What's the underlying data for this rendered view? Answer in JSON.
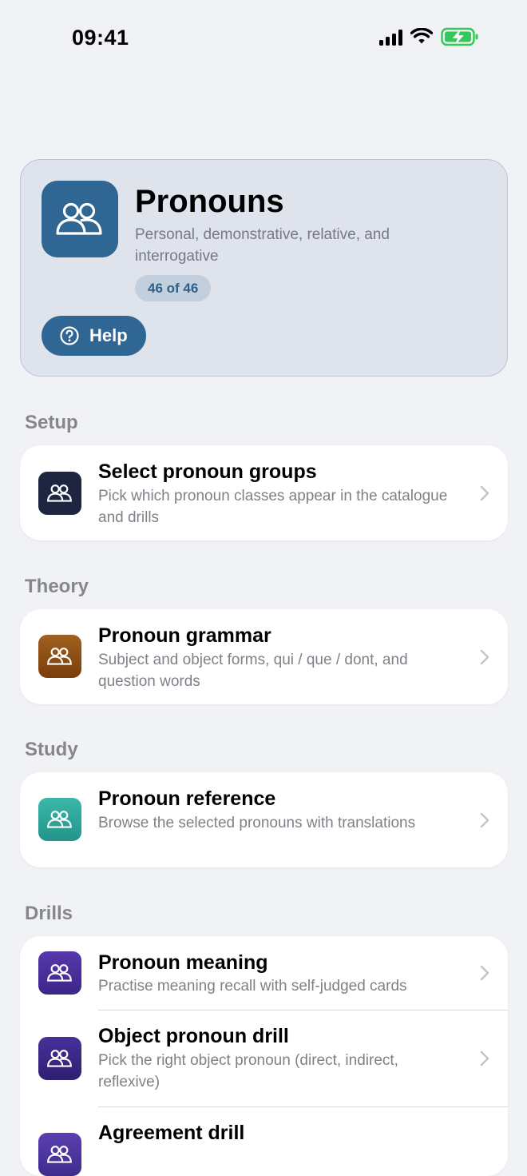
{
  "status": {
    "time": "09:41"
  },
  "hero": {
    "title": "Pronouns",
    "subtitle": "Personal, demonstrative, relative, and interrogative",
    "badge": "46 of 46",
    "help_label": "Help"
  },
  "sections": {
    "setup": {
      "header": "Setup",
      "items": [
        {
          "title": "Select pronoun groups",
          "subtitle": "Pick which pronoun classes appear in the catalogue and drills",
          "icon": "people-icon",
          "color": "#1e2540"
        }
      ]
    },
    "theory": {
      "header": "Theory",
      "items": [
        {
          "title": "Pronoun grammar",
          "subtitle": "Subject and object forms, qui / que / dont, and question words",
          "icon": "people-icon",
          "color": "#8a4a14"
        }
      ]
    },
    "study": {
      "header": "Study",
      "items": [
        {
          "title": "Pronoun reference",
          "subtitle": "Browse the selected pronouns with translations",
          "icon": "people-icon",
          "color": "#2fa79c"
        }
      ]
    },
    "drills": {
      "header": "Drills",
      "items": [
        {
          "title": "Pronoun meaning",
          "subtitle": "Practise meaning recall with self-judged cards",
          "icon": "people-icon",
          "color": "#4a2f9c"
        },
        {
          "title": "Object pronoun drill",
          "subtitle": "Pick the right object pronoun (direct, indirect, reflexive)",
          "icon": "people-icon",
          "color": "#3b2a88"
        },
        {
          "title": "Agreement drill",
          "subtitle": "",
          "icon": "people-icon",
          "color": "#4b35a0"
        }
      ]
    }
  },
  "colors": {
    "accent": "#2f6693",
    "background": "#f1f2f6",
    "battery": "#34c759"
  }
}
